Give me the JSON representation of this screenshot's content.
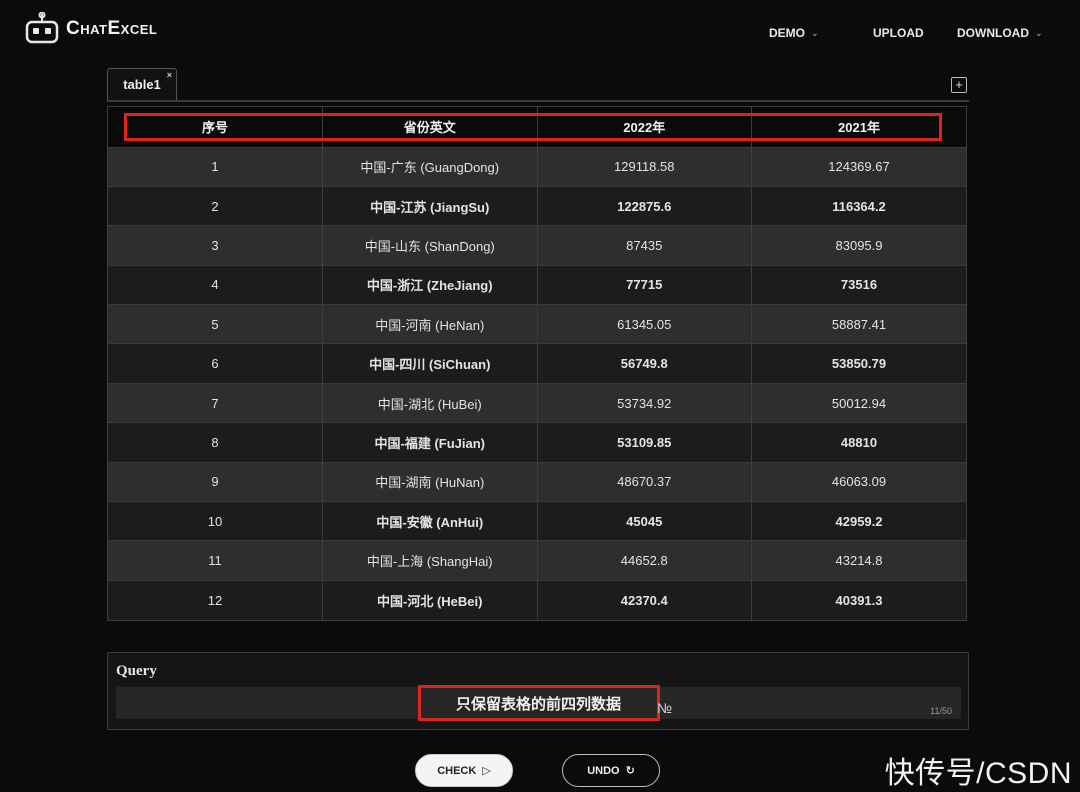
{
  "header": {
    "app_name": "ChatExcel",
    "nav": [
      {
        "label": "DEMO",
        "has_dropdown": true
      },
      {
        "label": "UPLOAD",
        "has_dropdown": false
      },
      {
        "label": "DOWNLOAD",
        "has_dropdown": true
      }
    ]
  },
  "tabs": [
    {
      "label": "table1",
      "closable": true,
      "active": true
    }
  ],
  "table": {
    "columns": [
      "序号",
      "省份英文",
      "2022年",
      "2021年"
    ],
    "rows": [
      [
        "1",
        "中国-广东 (GuangDong)",
        "129118.58",
        "124369.67"
      ],
      [
        "2",
        "中国-江苏 (JiangSu)",
        "122875.6",
        "116364.2"
      ],
      [
        "3",
        "中国-山东 (ShanDong)",
        "87435",
        "83095.9"
      ],
      [
        "4",
        "中国-浙江 (ZheJiang)",
        "77715",
        "73516"
      ],
      [
        "5",
        "中国-河南 (HeNan)",
        "61345.05",
        "58887.41"
      ],
      [
        "6",
        "中国-四川 (SiChuan)",
        "56749.8",
        "53850.79"
      ],
      [
        "7",
        "中国-湖北 (HuBei)",
        "53734.92",
        "50012.94"
      ],
      [
        "8",
        "中国-福建 (FuJian)",
        "53109.85",
        "48810"
      ],
      [
        "9",
        "中国-湖南 (HuNan)",
        "48670.37",
        "46063.09"
      ],
      [
        "10",
        "中国-安徽 (AnHui)",
        "45045",
        "42959.2"
      ],
      [
        "11",
        "中国-上海 (ShangHai)",
        "44652.8",
        "43214.8"
      ],
      [
        "12",
        "中国-河北 (HeBei)",
        "42370.4",
        "40391.3"
      ]
    ]
  },
  "query": {
    "label": "Query",
    "value": "只保留表格的前四列数据",
    "count": "11/50"
  },
  "actions": {
    "check_label": "CHECK",
    "undo_label": "UNDO"
  },
  "watermark": "快传号/CSDN",
  "colors": {
    "highlight": "#d9251f",
    "background": "#0b0b0b",
    "row_odd": "#2e2e2e",
    "row_even": "#1c1c1c"
  }
}
